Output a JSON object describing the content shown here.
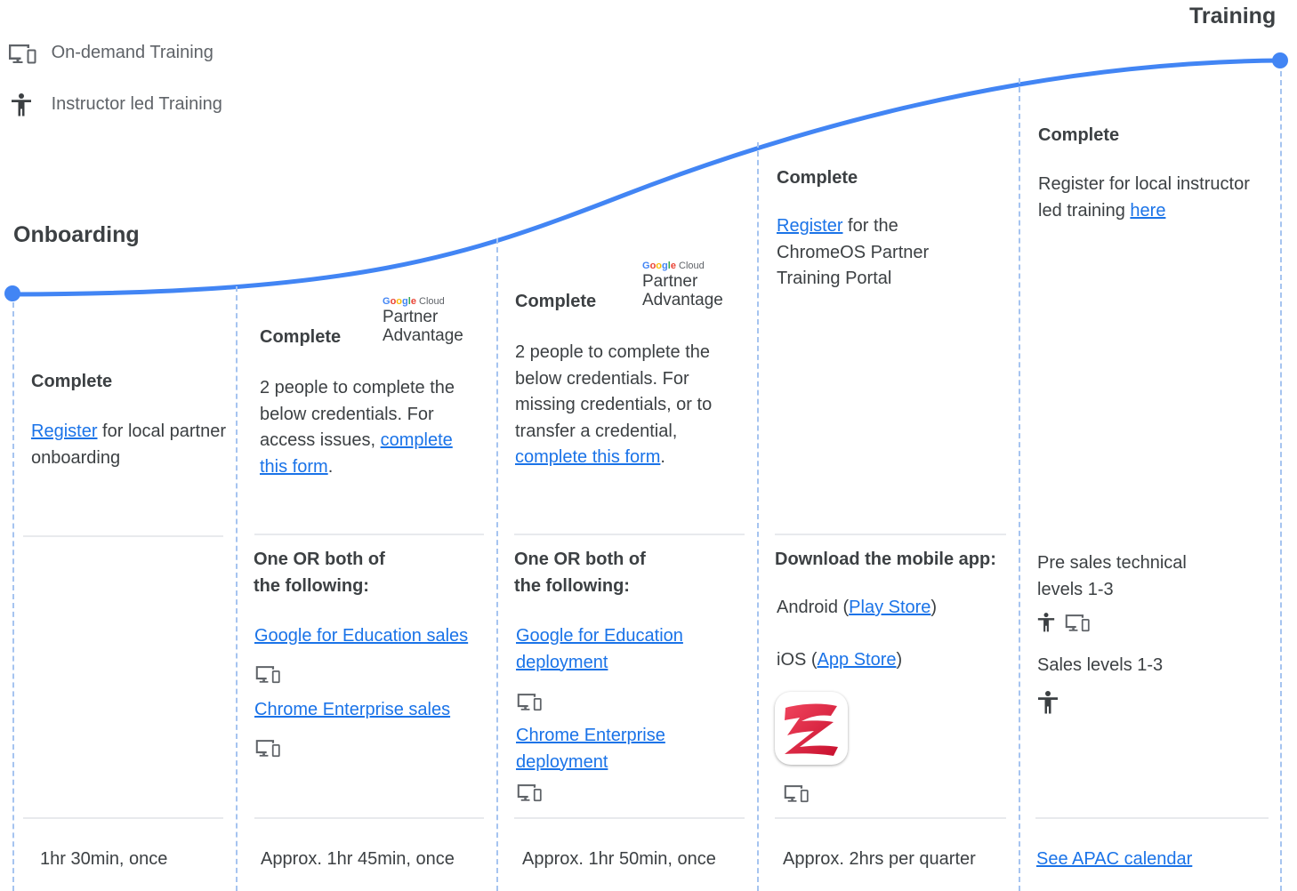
{
  "header": {
    "right_title": "Training",
    "left_title": "Onboarding"
  },
  "legend": [
    {
      "icon": "devices-icon",
      "label": "On-demand Training"
    },
    {
      "icon": "person-icon",
      "label": "Instructor led Training"
    }
  ],
  "logo": {
    "line1": "Google Cloud",
    "line2": "Partner",
    "line3": "Advantage"
  },
  "colors": {
    "curve": "#4285f4",
    "link": "#1a73e8",
    "dash": "#a6c4f0",
    "text": "#3c4043"
  },
  "columns": [
    {
      "heading": "Complete",
      "link": "Register",
      "text": " for local partner onboarding",
      "duration": "1hr 30min, once"
    },
    {
      "heading": "Complete",
      "intro": "2 people to complete the below credentials. For access issues, ",
      "link": "complete this form",
      "tail": ".",
      "sub_heading": "One OR both of the following:",
      "courses": [
        "Google for Education sales",
        "Chrome Enterprise sales"
      ],
      "duration": "Approx. 1hr 45min, once"
    },
    {
      "heading": "Complete",
      "intro": "2 people to complete the below credentials. For missing credentials, or to transfer a credential, ",
      "link": "complete this form",
      "tail": ".",
      "sub_heading": "One OR both of the following:",
      "courses": [
        "Google for Education deployment",
        "Chrome Enterprise deployment"
      ],
      "duration": "Approx. 1hr 50min, once"
    },
    {
      "heading": "Complete",
      "link": "Register",
      "text": " for the ChromeOS Partner Training Portal",
      "sub_heading": "Download the mobile app:",
      "android_prefix": "Android (",
      "android_link": "Play Store",
      "android_suffix": ")",
      "ios_prefix": "iOS (",
      "ios_link": "App Store",
      "ios_suffix": ")",
      "duration": "Approx. 2hrs per quarter"
    },
    {
      "heading": "Complete",
      "text": "Register for local instructor led training ",
      "link": "here",
      "item1": "Pre sales technical levels 1-3",
      "item2": "Sales levels 1-3",
      "duration_link": "See APAC calendar"
    }
  ]
}
